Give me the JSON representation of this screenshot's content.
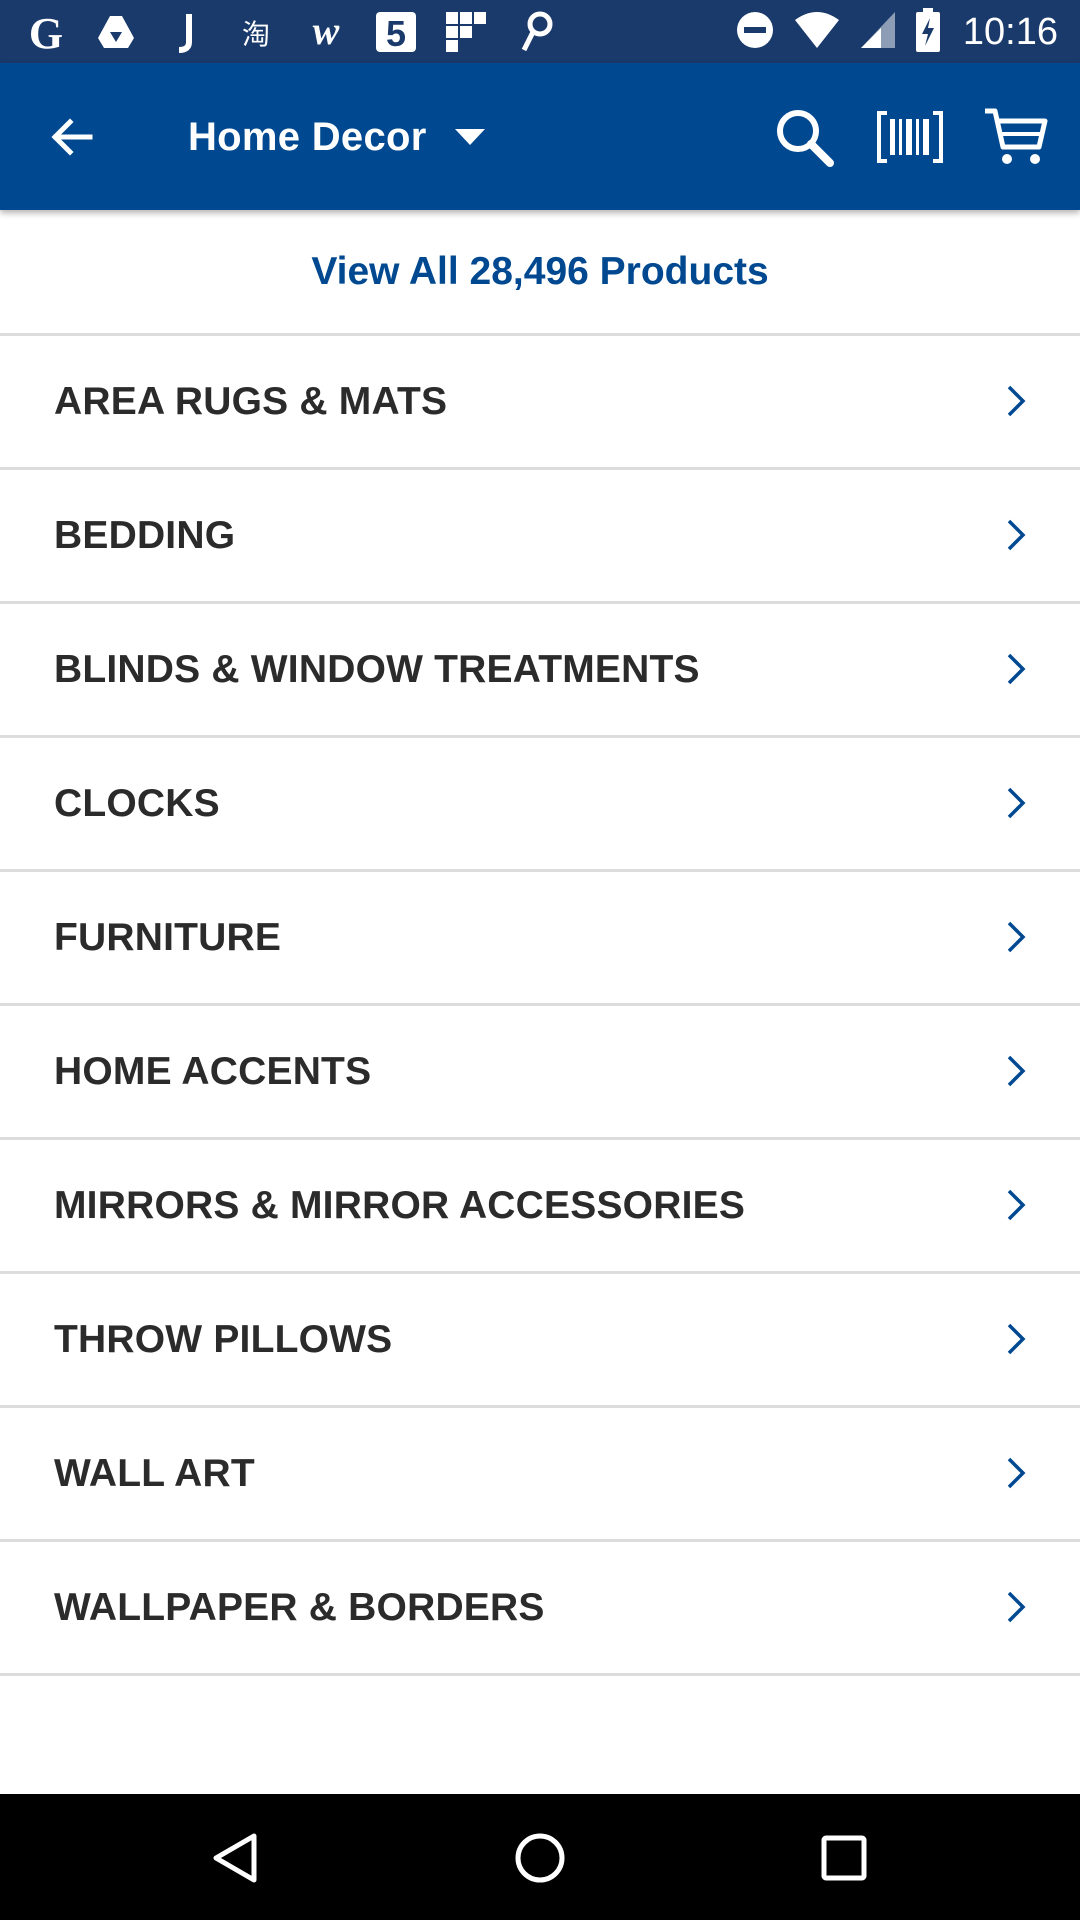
{
  "status_bar": {
    "time": "10:16",
    "notification_icons": [
      "google-icon",
      "drive-icon",
      "j-app-icon",
      "taobao-icon",
      "w-app-icon",
      "five-app-icon",
      "grid-app-icon",
      "pinterest-icon"
    ],
    "system_icons": [
      "do-not-disturb-icon",
      "wifi-icon",
      "cell-signal-icon",
      "battery-charging-icon"
    ]
  },
  "app_bar": {
    "title": "Home Decor",
    "background_color": "#004990",
    "icons": [
      "back-arrow-icon",
      "dropdown-caret-icon",
      "search-icon",
      "barcode-scanner-icon",
      "cart-icon"
    ]
  },
  "view_all": {
    "label": "View All 28,496 Products",
    "color": "#004990"
  },
  "categories": [
    {
      "label": "AREA RUGS & MATS"
    },
    {
      "label": "BEDDING"
    },
    {
      "label": "BLINDS & WINDOW TREATMENTS"
    },
    {
      "label": "CLOCKS"
    },
    {
      "label": "FURNITURE"
    },
    {
      "label": "HOME ACCENTS"
    },
    {
      "label": "MIRRORS & MIRROR ACCESSORIES"
    },
    {
      "label": "THROW PILLOWS"
    },
    {
      "label": "WALL ART"
    },
    {
      "label": "WALLPAPER & BORDERS"
    }
  ],
  "nav_bar": {
    "icons": [
      "nav-back-icon",
      "nav-home-icon",
      "nav-recents-icon"
    ]
  }
}
